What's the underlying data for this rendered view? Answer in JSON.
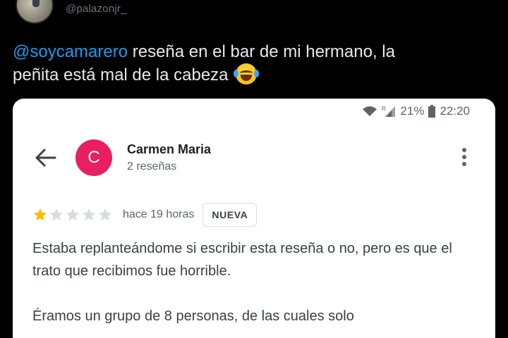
{
  "tweet": {
    "handle": "@palazonjr_",
    "mention": "@soycamarero",
    "text_line1_rest": " reseña en el bar de mi hermano, la",
    "text_line2": "peñita está mal de la cabeza",
    "emoji": "face-with-tears-of-joy"
  },
  "phone_status": {
    "battery": "21%",
    "time": "22:20",
    "roaming_indicator": "R"
  },
  "review": {
    "author_initial": "C",
    "author_name": "Carmen Maria",
    "author_reviews": "2 reseñas",
    "rating": 1,
    "rating_max": 5,
    "time": "hace 19 horas",
    "badge": "NUEVA",
    "paragraph1": "Estaba replanteándome si escribir esta reseña o no, pero es que el trato que recibimos fue horrible.",
    "paragraph2": "Éramos un grupo de 8 personas, de las cuales solo"
  },
  "colors": {
    "mention": "#1d9bf0",
    "author_avatar": "#e91e63",
    "star_filled": "#fbbc04",
    "star_empty": "#dadce0"
  }
}
